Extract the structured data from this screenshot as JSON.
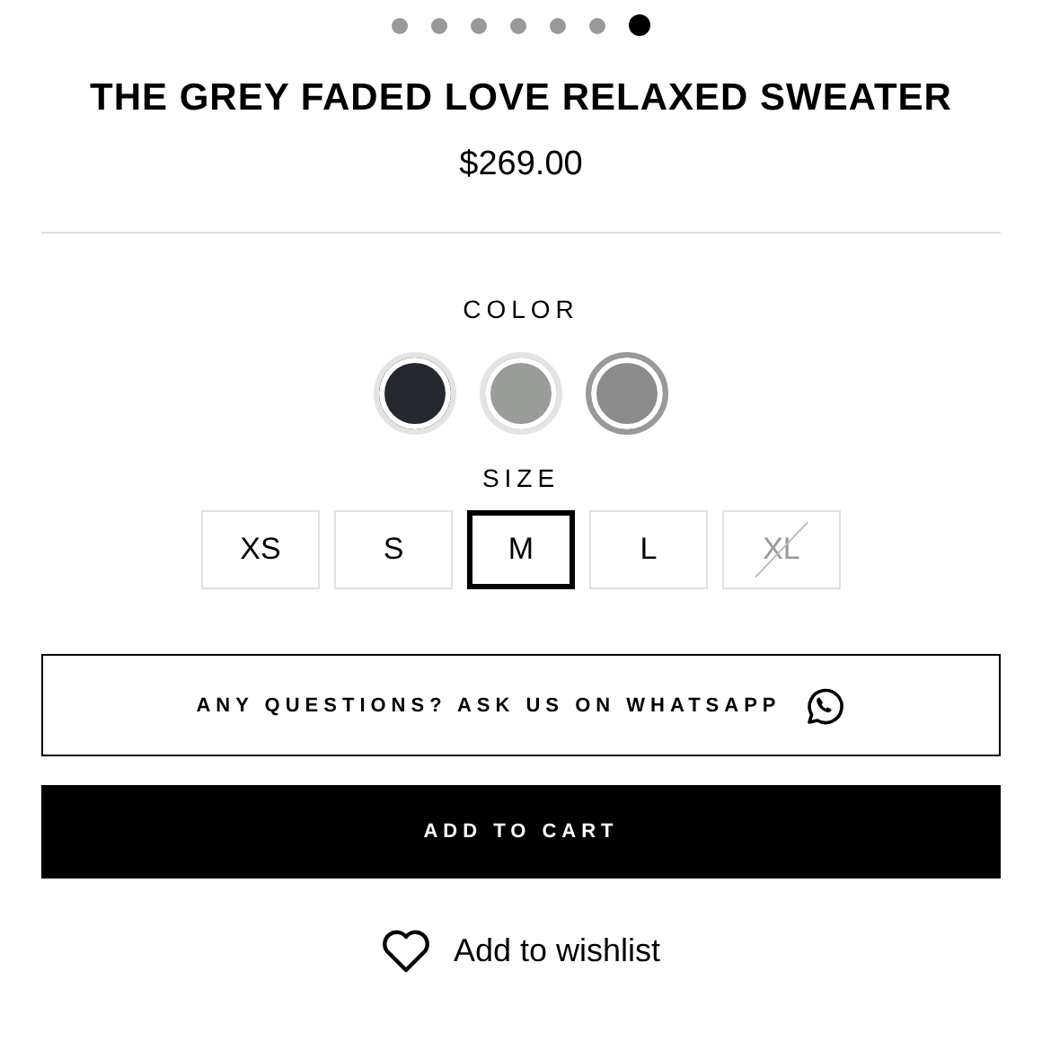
{
  "carousel": {
    "dots": [
      {
        "selected": false
      },
      {
        "selected": false
      },
      {
        "selected": false
      },
      {
        "selected": false
      },
      {
        "selected": false
      },
      {
        "selected": false
      },
      {
        "selected": true
      }
    ]
  },
  "product": {
    "title": "THE GREY FADED LOVE RELAXED SWEATER",
    "price": "$269.00"
  },
  "color": {
    "label": "COLOR",
    "swatches": [
      {
        "color": "#25282d",
        "selected": false
      },
      {
        "color": "#9a9c9a",
        "selected": false
      },
      {
        "color": "#8d8c8c",
        "selected": true
      }
    ]
  },
  "size": {
    "label": "SIZE",
    "options": [
      {
        "label": "XS",
        "selected": false,
        "disabled": false
      },
      {
        "label": "S",
        "selected": false,
        "disabled": false
      },
      {
        "label": "M",
        "selected": true,
        "disabled": false
      },
      {
        "label": "L",
        "selected": false,
        "disabled": false
      },
      {
        "label": "XL",
        "selected": false,
        "disabled": true
      }
    ]
  },
  "whatsapp_button": "ANY QUESTIONS? ASK US ON WHATSAPP",
  "cart_button": "ADD TO CART",
  "wishlist_link": "Add to wishlist"
}
